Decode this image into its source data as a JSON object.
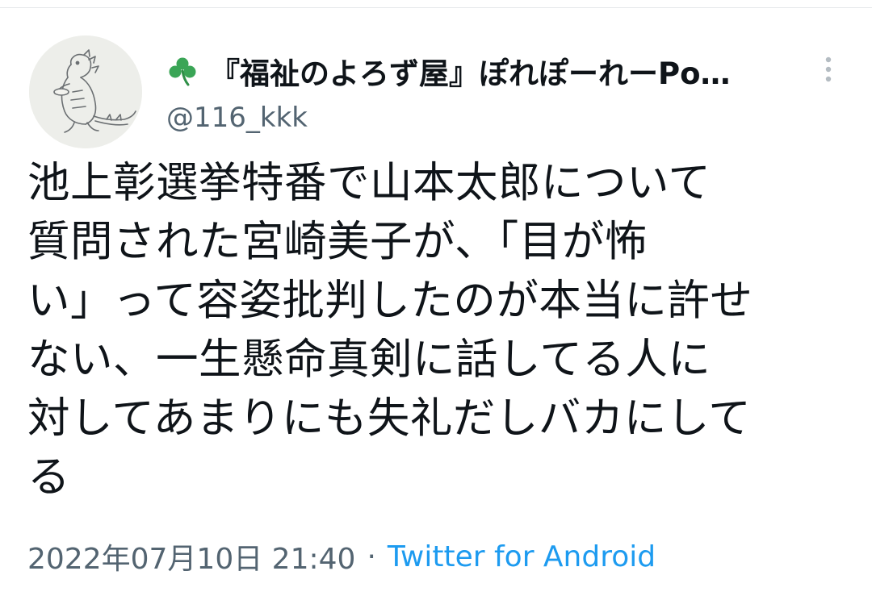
{
  "tweet": {
    "author": {
      "display_name": "『福祉のよろず屋』ぽれぽーれーPo…",
      "name_emoji_icon": "shamrock-icon",
      "handle": "@116_kkk",
      "avatar_icon": "godzilla-sketch-avatar"
    },
    "text": "池上彰選挙特番で山本太郎について\n質問された宮崎美子が、「目が怖\nい」って容姿批判したのが本当に許せ\nない、一生懸命真剣に話してる人に\n対してあまりにも失礼だしバカにして\nる",
    "timestamp": "2022年07月10日 21:40",
    "separator": "·",
    "client": "Twitter for Android",
    "more_icon": "more-vertical-icon"
  },
  "colors": {
    "text_primary": "#0f1419",
    "text_secondary": "#536471",
    "link": "#1d9bf0",
    "clover": "#3aa556"
  }
}
